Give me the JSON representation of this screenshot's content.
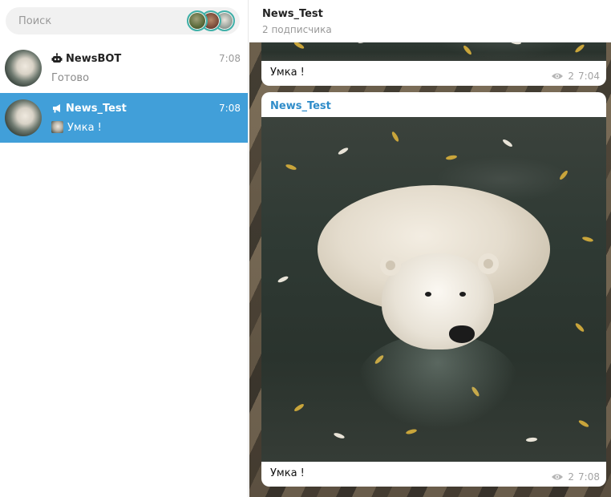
{
  "search": {
    "placeholder": "Поиск"
  },
  "stories": [
    {
      "name": "story-1"
    },
    {
      "name": "story-2"
    },
    {
      "name": "story-3"
    }
  ],
  "chats": [
    {
      "name": "NewsBOT",
      "type_icon": "bot-icon",
      "time": "7:08",
      "preview": "Готово",
      "selected": false
    },
    {
      "name": "News_Test",
      "type_icon": "channel-megaphone-icon",
      "time": "7:08",
      "preview": "Умка !",
      "selected": true
    }
  ],
  "header": {
    "title": "News_Test",
    "subtitle": "2 подписчика"
  },
  "messages": [
    {
      "caption": "Умка !",
      "views": "2",
      "time": "7:04"
    },
    {
      "sender": "News_Test",
      "caption": "Умка !",
      "views": "2",
      "time": "7:08"
    }
  ],
  "colors": {
    "accent": "#419fd9",
    "sender": "#2f8cc9",
    "story_ring": "#3fb0a8"
  }
}
